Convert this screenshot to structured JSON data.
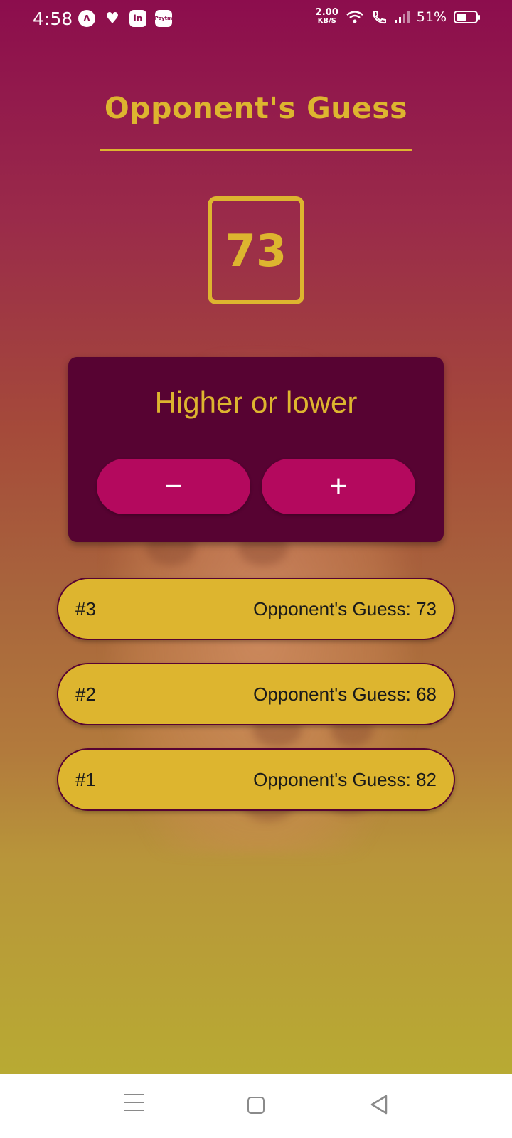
{
  "status_bar": {
    "time": "4:58",
    "net_speed_value": "2.00",
    "net_speed_unit": "KB/S",
    "battery": "51%",
    "battery_level": 0.51,
    "icons": [
      "app-a-icon",
      "heart-icon",
      "linkedin-icon",
      "paytm-icon",
      "wifi-icon",
      "wifi-call-icon",
      "signal-icon",
      "battery-icon"
    ]
  },
  "screen": {
    "title": "Opponent's Guess",
    "current_guess": "73",
    "prompt": "Higher or lower",
    "minus_label": "−",
    "plus_label": "+"
  },
  "guess_log": [
    {
      "round": "#3",
      "text": "Opponent's Guess: 73"
    },
    {
      "round": "#2",
      "text": "Opponent's Guess: 68"
    },
    {
      "round": "#1",
      "text": "Opponent's Guess: 82"
    }
  ],
  "colors": {
    "accent": "#ddb52f",
    "card": "#570332",
    "button": "#b4095e",
    "background_top": "#8c0d4d",
    "background_bottom": "#b8aa33"
  },
  "nav_bar": {
    "icons": [
      "menu-icon",
      "home-icon",
      "back-icon"
    ]
  }
}
